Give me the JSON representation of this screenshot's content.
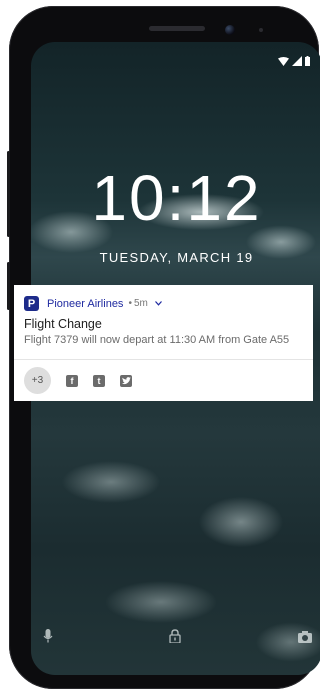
{
  "lockscreen": {
    "time": "10:12",
    "date": "TUESDAY, MARCH 19"
  },
  "status_bar": {
    "icons": [
      "wifi-icon",
      "signal-icon",
      "battery-icon"
    ]
  },
  "notification": {
    "app_logo_letter": "P",
    "app_name": "Pioneer Airlines",
    "separator": "•",
    "time_ago": "5m",
    "title": "Flight Change",
    "body": "Flight 7379 will now depart at 11:30 AM from Gate A55",
    "more_count": "+3",
    "actions": [
      {
        "icon": "facebook-icon",
        "glyph": "f"
      },
      {
        "icon": "tumblr-icon",
        "glyph": "t"
      },
      {
        "icon": "twitter-icon",
        "glyph": "bird"
      }
    ],
    "colors": {
      "app_name": "#1f2aa0",
      "logo_bg": "#1d2b8a"
    }
  },
  "bottom_shortcuts": [
    "microphone-icon",
    "lock-icon",
    "camera-icon"
  ]
}
